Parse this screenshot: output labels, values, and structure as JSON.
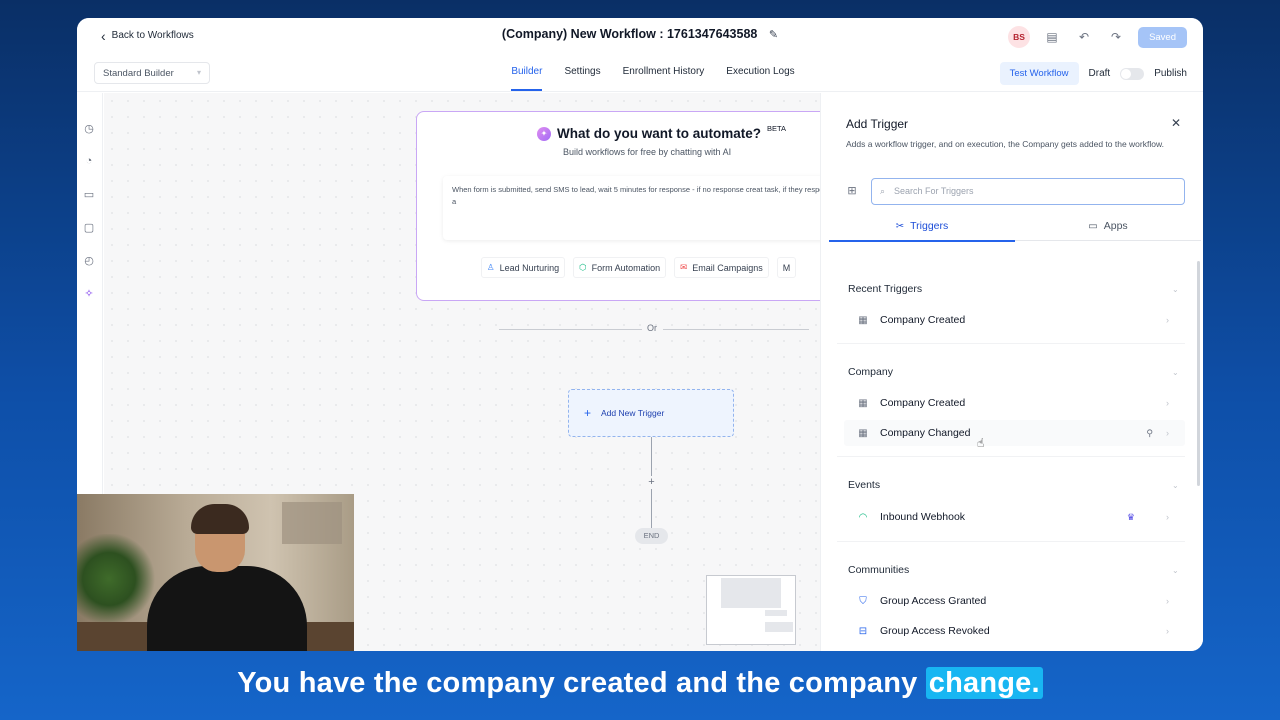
{
  "header": {
    "back_label": "Back to Workflows",
    "title": "(Company) New Workflow : 1761347643588",
    "avatar_initials": "BS",
    "saved_label": "Saved"
  },
  "subbar": {
    "builder_select": "Standard Builder",
    "tabs": [
      "Builder",
      "Settings",
      "Enrollment History",
      "Execution Logs"
    ],
    "active_tab": "Builder",
    "test_label": "Test Workflow",
    "draft_label": "Draft",
    "publish_label": "Publish"
  },
  "ai": {
    "title": "What do you want to automate?",
    "beta": "BETA",
    "subtitle": "Build workflows for free by chatting with AI",
    "prompt_text": "When form is submitted, send SMS to lead, wait 5 minutes for response - if no response creat task, if they respond a",
    "chips": [
      "Lead Nurturing",
      "Form Automation",
      "Email Campaigns",
      "M"
    ]
  },
  "canvas": {
    "or_label": "Or",
    "add_trigger_label": "Add New Trigger",
    "add_step": "+",
    "end_label": "END"
  },
  "panel": {
    "title": "Add Trigger",
    "description": "Adds a workflow trigger, and on execution, the Company gets added to the workflow.",
    "search_placeholder": "Search For Triggers",
    "tab_triggers": "Triggers",
    "tab_apps": "Apps",
    "sections": [
      {
        "name": "Recent Triggers",
        "items": [
          "Company Created"
        ]
      },
      {
        "name": "Company",
        "items": [
          "Company Created",
          "Company Changed"
        ]
      },
      {
        "name": "Events",
        "items": [
          "Inbound Webhook"
        ]
      },
      {
        "name": "Communities",
        "items": [
          "Group Access Granted",
          "Group Access Revoked"
        ]
      }
    ]
  },
  "caption": {
    "text": "You have the company created and the company",
    "highlight": "change."
  }
}
